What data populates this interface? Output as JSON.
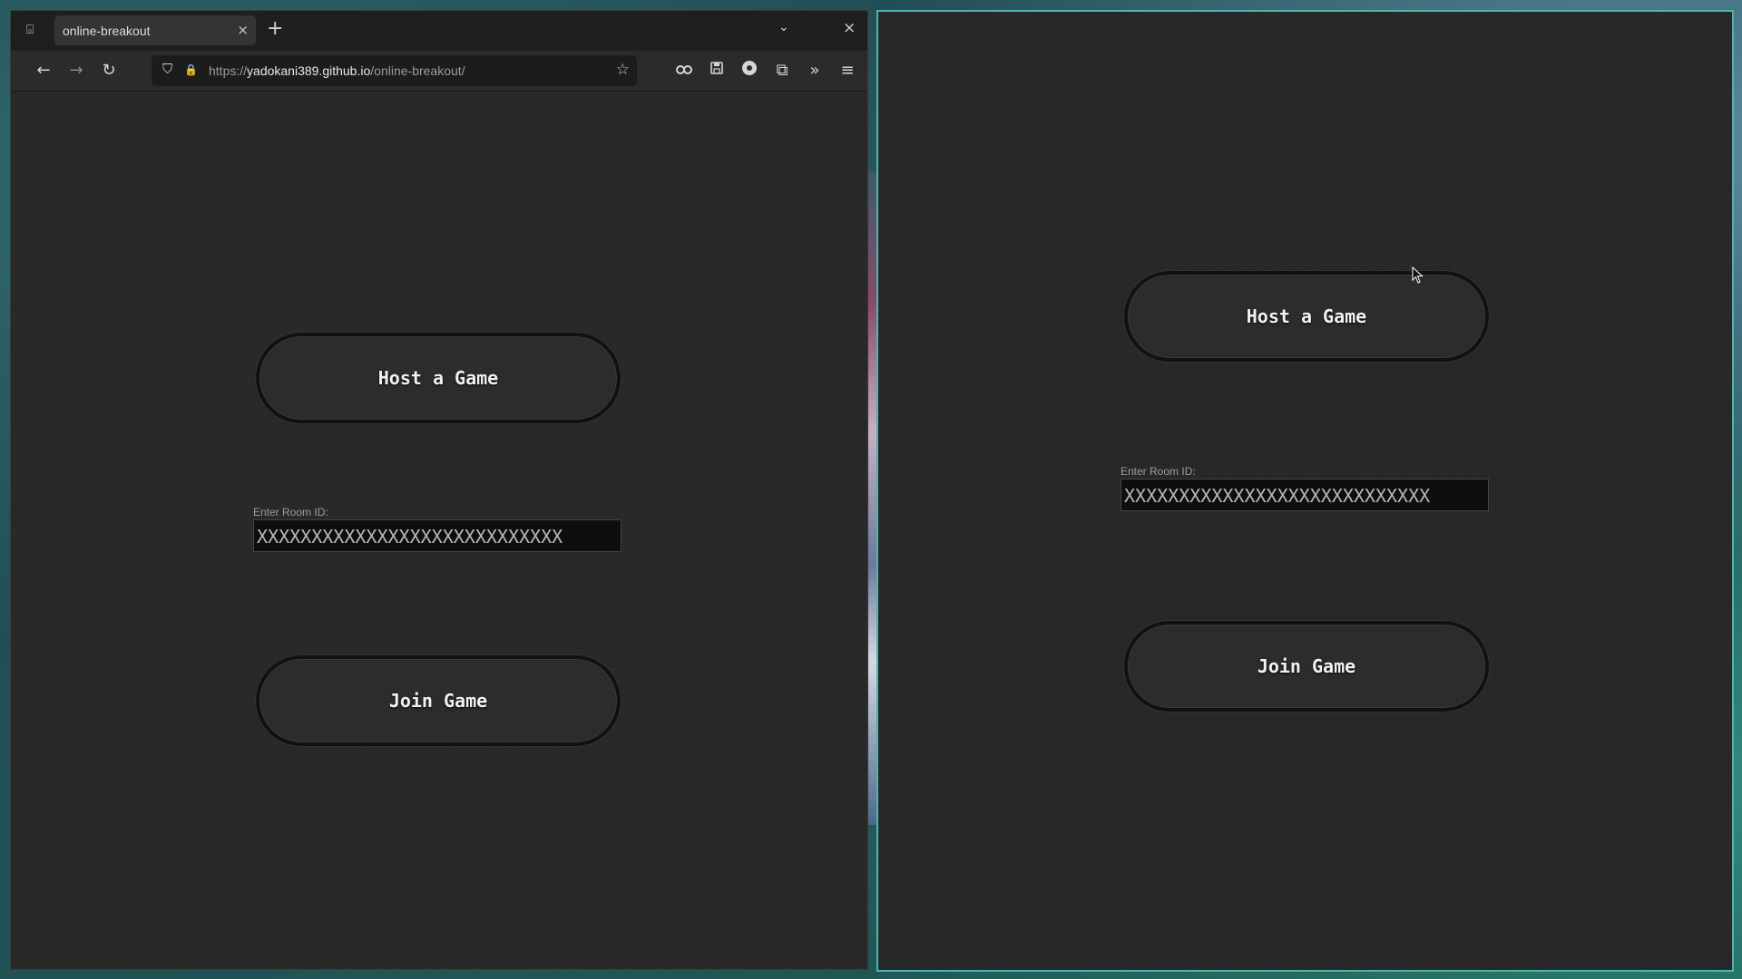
{
  "browser": {
    "tab_title": "online-breakout",
    "tab_close": "×",
    "new_tab": "+",
    "tab_list_icon": "⌺",
    "tab_overflow_icon": "⌄",
    "window_close": "×",
    "url_scheme": "https://",
    "url_host": "yadokani389.github.io",
    "url_path": "/online-breakout/",
    "nav": {
      "back": "←",
      "forward": "→",
      "reload": "↻",
      "shield": "⛉",
      "lock": "🔒",
      "star": "☆",
      "extensions_icon": "⧉",
      "overflow_icon": "»",
      "menu_icon": "≡"
    }
  },
  "left_app": {
    "host_label": "Host a Game",
    "room_label": "Enter Room ID:",
    "room_value": "XXXXXXXXXXXXXXXXXXXXXXXXXXXX",
    "join_label": "Join Game"
  },
  "right_app": {
    "host_label": "Host a Game",
    "room_label": "Enter Room ID:",
    "room_value": "XXXXXXXXXXXXXXXXXXXXXXXXXXXX",
    "join_label": "Join Game"
  },
  "colors": {
    "window_bg": "#272727",
    "right_window_border": "#4fb3b0",
    "button_border": "#111111",
    "input_bg": "#0e0e0e"
  }
}
